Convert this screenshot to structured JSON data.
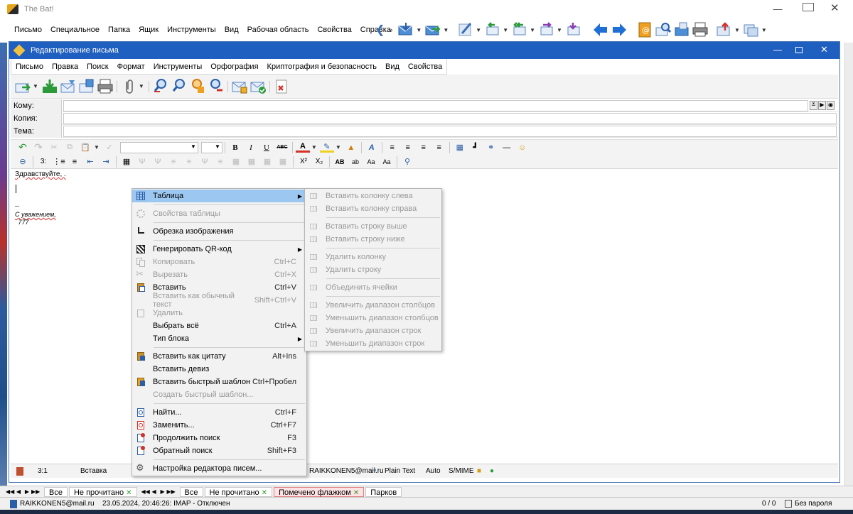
{
  "app": {
    "title": "The Bat!"
  },
  "main_menu": [
    "Письмо",
    "Специальное",
    "Папка",
    "Ящик",
    "Инструменты",
    "Вид",
    "Рабочая область",
    "Свойства",
    "Справка"
  ],
  "editor": {
    "title": "Редактирование письма",
    "menu": [
      "Письмо",
      "Правка",
      "Поиск",
      "Формат",
      "Инструменты",
      "Орфография",
      "Криптография и безопасность",
      "Вид",
      "Свойства"
    ],
    "fields": {
      "to_label": "Кому:",
      "cc_label": "Копия:",
      "subject_label": "Тема:"
    },
    "body": {
      "greeting": "Здравствуйте, .",
      "dashes": "--",
      "regards": "С уважением,",
      "sig": " 777"
    },
    "status": {
      "pos": "3:1",
      "mode": "Вставка",
      "account": "RAIKKONEN5@mail.ru",
      "format": "Plain Text",
      "charset": "Auto",
      "smime": "S/MIME"
    }
  },
  "context_menu": {
    "items": [
      {
        "label": "Таблица",
        "shortcut": "",
        "icon": "table-icon",
        "submenu": true,
        "highlighted": true
      },
      {
        "sep": true
      },
      {
        "label": "Свойства таблицы",
        "shortcut": "",
        "icon": "table-properties-icon",
        "disabled": true
      },
      {
        "sep": true
      },
      {
        "label": "Обрезка изображения",
        "shortcut": "",
        "icon": "crop-icon"
      },
      {
        "sep": true
      },
      {
        "label": "Генерировать QR-код",
        "shortcut": "",
        "icon": "qr-code-icon",
        "submenu": true
      },
      {
        "label": "Копировать",
        "shortcut": "Ctrl+C",
        "icon": "copy-icon",
        "disabled": true
      },
      {
        "label": "Вырезать",
        "shortcut": "Ctrl+X",
        "icon": "cut-icon",
        "disabled": true
      },
      {
        "label": "Вставить",
        "shortcut": "Ctrl+V",
        "icon": "paste-icon"
      },
      {
        "label": "Вставить как обычный текст",
        "shortcut": "Shift+Ctrl+V",
        "icon": "",
        "disabled": true
      },
      {
        "label": "Удалить",
        "shortcut": "",
        "icon": "delete-icon",
        "disabled": true
      },
      {
        "label": "Выбрать всё",
        "shortcut": "Ctrl+A",
        "icon": ""
      },
      {
        "label": "Тип блока",
        "shortcut": "",
        "icon": "",
        "submenu": true
      },
      {
        "sep": true
      },
      {
        "label": "Вставить как цитату",
        "shortcut": "Alt+Ins",
        "icon": "quote-icon"
      },
      {
        "label": "Вставить девиз",
        "shortcut": "",
        "icon": ""
      },
      {
        "label": "Вставить быстрый шаблон",
        "shortcut": "Ctrl+Пробел",
        "icon": "template-icon"
      },
      {
        "label": "Создать быстрый шаблон...",
        "shortcut": "",
        "icon": "",
        "disabled": true
      },
      {
        "sep": true
      },
      {
        "label": "Найти...",
        "shortcut": "Ctrl+F",
        "icon": "find-icon"
      },
      {
        "label": "Заменить...",
        "shortcut": "Ctrl+F7",
        "icon": "replace-icon"
      },
      {
        "label": "Продолжить поиск",
        "shortcut": "F3",
        "icon": "find-next-icon"
      },
      {
        "label": "Обратный поиск",
        "shortcut": "Shift+F3",
        "icon": "find-prev-icon"
      },
      {
        "sep": true
      },
      {
        "label": "Настройка редактора писем...",
        "shortcut": "",
        "icon": "settings-icon"
      }
    ]
  },
  "table_submenu": {
    "items": [
      {
        "label": "Вставить колонку слева"
      },
      {
        "label": "Вставить колонку справа"
      },
      {
        "sep": true
      },
      {
        "label": "Вставить строку выше"
      },
      {
        "label": "Вставить строку ниже"
      },
      {
        "sep": true
      },
      {
        "label": "Удалить колонку"
      },
      {
        "label": "Удалить строку"
      },
      {
        "sep": true
      },
      {
        "label": "Объединить ячейки"
      },
      {
        "sep": true
      },
      {
        "label": "Увеличить диапазон столбцов"
      },
      {
        "label": "Уменьшить диапазон столбцов"
      },
      {
        "label": "Увеличить диапазон строк"
      },
      {
        "label": "Уменьшить диапазон строк"
      }
    ]
  },
  "folder_tabs_left": [
    "Все",
    "Не прочитано"
  ],
  "folder_tabs_right": [
    "Все",
    "Не прочитано",
    "Помечено флажком",
    "Парков"
  ],
  "statusbar": {
    "account": "RAIKKONEN5@mail.ru",
    "info": "23.05.2024, 20:46:26: IMAP  - Отключен",
    "counter": "0 / 0",
    "password": "Без пароля"
  },
  "colors": {
    "title_blue": "#1f5fbf",
    "highlight": "#9cc7f0",
    "disabled_text": "#9a9a9a"
  }
}
